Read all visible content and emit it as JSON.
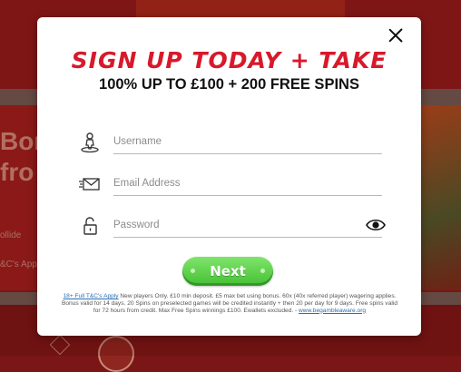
{
  "background": {
    "hero_line_1": "Bon",
    "hero_line_2": "fro",
    "side_text_1": "ollide",
    "side_text_2": "&C's Appl"
  },
  "modal": {
    "title": "SIGN UP TODAY + TAKE",
    "subtitle": "100% UP TO £100 + 200 FREE SPINS",
    "fields": {
      "username_placeholder": "Username",
      "email_placeholder": "Email Address",
      "password_placeholder": "Password"
    },
    "next_label": "Next",
    "terms": {
      "link_label": "18+ Full T&C's Apply",
      "body": " New players Only. £10 min deposit. £5 max bet using bonus. 60x (40x referred player) wagering applies. Bonus valid for 14 days. 20 Spins on preselected games will be credited instantly + then 20 per day for 9 days. Free spins valid for 72 hours from credit. Max Free Spins winnings £100. Ewallets excluded. - ",
      "gamble_link": "www.begambleaware.org"
    }
  },
  "colors": {
    "title_red": "#d8192b",
    "button_green": "#46bf35",
    "link_blue": "#2a6fb0"
  },
  "icons": [
    "user-icon",
    "envelope-icon",
    "lock-icon",
    "eye-icon",
    "close-icon"
  ]
}
